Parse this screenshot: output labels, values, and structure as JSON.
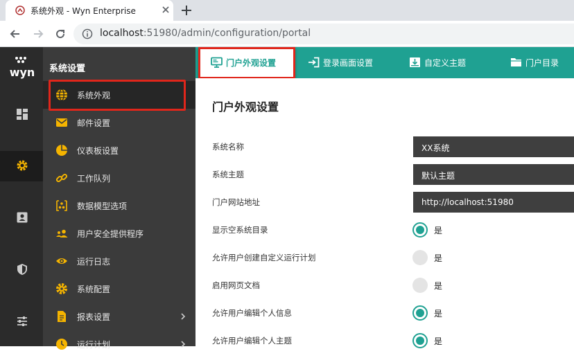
{
  "browser": {
    "tab_title": "系统外观 - Wyn Enterprise",
    "url_host": "localhost",
    "url_path": ":51980/admin/configuration/portal"
  },
  "rail": {
    "logo_text": "wyn",
    "items": [
      "dashboard-icon",
      "settings-gear-icon",
      "user-card-icon",
      "shield-icon",
      "sliders-icon"
    ]
  },
  "sidebar": {
    "title": "系统设置",
    "items": [
      {
        "label": "系统外观",
        "icon": "globe-icon"
      },
      {
        "label": "邮件设置",
        "icon": "mail-icon"
      },
      {
        "label": "仪表板设置",
        "icon": "pie-icon"
      },
      {
        "label": "工作队列",
        "icon": "link-icon"
      },
      {
        "label": "数据模型选项",
        "icon": "model-icon"
      },
      {
        "label": "用户安全提供程序",
        "icon": "users-icon"
      },
      {
        "label": "运行日志",
        "icon": "eye-icon"
      },
      {
        "label": "系统配置",
        "icon": "cog-icon"
      },
      {
        "label": "报表设置",
        "icon": "report-icon"
      },
      {
        "label": "运行计划",
        "icon": "clock-icon"
      }
    ]
  },
  "tabs": [
    {
      "label": "门户外观设置",
      "icon": "monitor-icon"
    },
    {
      "label": "登录画面设置",
      "icon": "login-icon"
    },
    {
      "label": "自定义主题",
      "icon": "theme-icon"
    },
    {
      "label": "门户目录",
      "icon": "folder-icon"
    }
  ],
  "main": {
    "title": "门户外观设置",
    "fields": [
      {
        "label": "系统名称",
        "value": "XX系统"
      },
      {
        "label": "系统主题",
        "value": "默认主题"
      },
      {
        "label": "门户网站地址",
        "value": "http://localhost:51980"
      }
    ],
    "toggles": [
      {
        "label": "显示空系统目录",
        "option": "是",
        "checked": true
      },
      {
        "label": "允许用户创建自定义运行计划",
        "option": "是",
        "checked": false
      },
      {
        "label": "启用网页文档",
        "option": "是",
        "checked": false
      },
      {
        "label": "允许用户编辑个人信息",
        "option": "是",
        "checked": true
      },
      {
        "label": "允许用户编辑个人主题",
        "option": "是",
        "checked": true
      }
    ]
  },
  "colors": {
    "accent": "#1fa192",
    "highlight": "#e0261b",
    "rail": "#2b2b2b",
    "sidebar": "#3b3b3b"
  }
}
